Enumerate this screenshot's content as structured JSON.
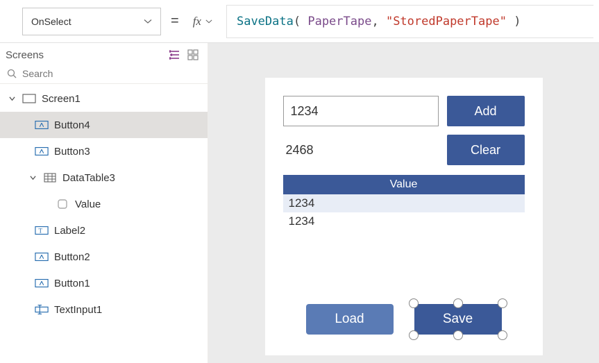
{
  "header": {
    "property_selector": "OnSelect",
    "fx_label": "fx",
    "formula": {
      "fn": "SaveData",
      "open": "( ",
      "arg1": "PaperTape",
      "sep": ", ",
      "arg2": "\"StoredPaperTape\"",
      "close": " )"
    }
  },
  "sidebar": {
    "title": "Screens",
    "search_placeholder": "Search",
    "items": [
      {
        "label": "Screen1",
        "type": "screen"
      },
      {
        "label": "Button4",
        "type": "button"
      },
      {
        "label": "Button3",
        "type": "button"
      },
      {
        "label": "DataTable3",
        "type": "datatable"
      },
      {
        "label": "Value",
        "type": "column"
      },
      {
        "label": "Label2",
        "type": "label"
      },
      {
        "label": "Button2",
        "type": "button"
      },
      {
        "label": "Button1",
        "type": "button"
      },
      {
        "label": "TextInput1",
        "type": "textinput"
      }
    ]
  },
  "canvas": {
    "textinput_value": "1234",
    "add_label": "Add",
    "result_label": "2468",
    "clear_label": "Clear",
    "table_header": "Value",
    "rows": [
      "1234",
      "1234"
    ],
    "load_label": "Load",
    "save_label": "Save"
  }
}
